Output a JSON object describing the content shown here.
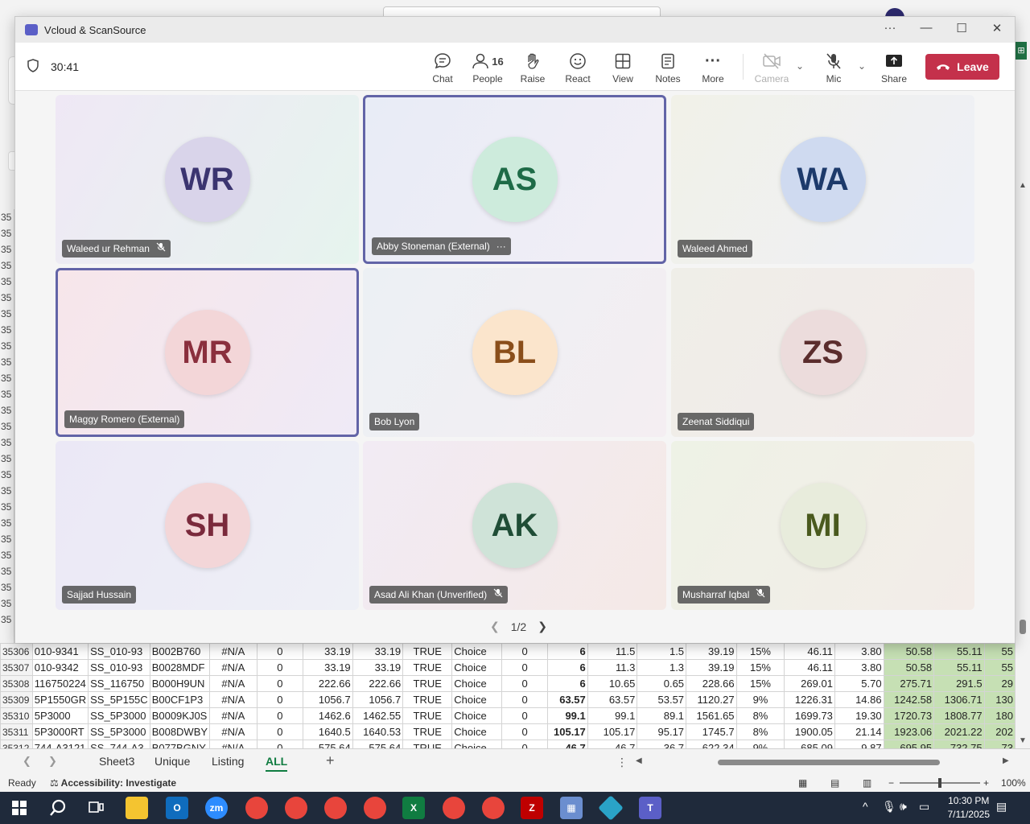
{
  "teams": {
    "window_title": "Vcloud & ScanSource",
    "timer": "30:41",
    "toolbar": {
      "chat": "Chat",
      "people": "People",
      "people_count": "16",
      "raise": "Raise",
      "react": "React",
      "view": "View",
      "notes": "Notes",
      "more": "More",
      "camera": "Camera",
      "mic": "Mic",
      "share": "Share",
      "leave": "Leave"
    },
    "participants": [
      {
        "initials": "WR",
        "name": "Waleed ur Rehman",
        "muted": true,
        "active": false,
        "color": "#d9d4ea",
        "text": "#3b3470"
      },
      {
        "initials": "AS",
        "name": "Abby Stoneman (External)",
        "muted": false,
        "active": true,
        "color": "#cdebdc",
        "text": "#1e6b47"
      },
      {
        "initials": "WA",
        "name": "Waleed Ahmed",
        "muted": false,
        "active": false,
        "color": "#cfdaf0",
        "text": "#1d3a6b"
      },
      {
        "initials": "MR",
        "name": "Maggy Romero (External)",
        "muted": false,
        "active": true,
        "color": "#f3d6d8",
        "text": "#8a2f3d"
      },
      {
        "initials": "BL",
        "name": "Bob Lyon",
        "muted": false,
        "active": false,
        "color": "#fbe5cc",
        "text": "#8a4e1a"
      },
      {
        "initials": "ZS",
        "name": "Zeenat Siddiqui",
        "muted": false,
        "active": false,
        "color": "#ecdcdc",
        "text": "#5b2d2d"
      },
      {
        "initials": "SH",
        "name": "Sajjad Hussain",
        "muted": false,
        "active": false,
        "color": "#f3d6d8",
        "text": "#7a2a3c"
      },
      {
        "initials": "AK",
        "name": "Asad Ali Khan (Unverified)",
        "muted": true,
        "active": false,
        "color": "#cfe3d8",
        "text": "#1f4d36"
      },
      {
        "initials": "MI",
        "name": "Musharraf Iqbal",
        "muted": true,
        "active": false,
        "color": "#e8ecdc",
        "text": "#4a5a1e"
      }
    ],
    "pager": "1/2"
  },
  "excel": {
    "rownums_visible": [
      "35",
      "35",
      "35",
      "35",
      "35",
      "35",
      "35",
      "35",
      "35",
      "35",
      "35",
      "35",
      "35",
      "35",
      "35",
      "35",
      "35",
      "35",
      "35",
      "35",
      "35",
      "35",
      "35",
      "35",
      "35",
      "35"
    ],
    "rows": [
      {
        "n": "35306",
        "a": "010-9341",
        "b": "SS_010-93",
        "c": "B002B760",
        "d": "#N/A",
        "e": "0",
        "f": "33.19",
        "g": "33.19",
        "h": "TRUE",
        "i": "Choice",
        "j": "0",
        "k": "6",
        "l": "11.5",
        "m": "1.5",
        "o": "39.19",
        "p": "15%",
        "q": "46.11",
        "r": "3.80",
        "s": "50.58",
        "t": "55.11",
        "u": "55"
      },
      {
        "n": "35307",
        "a": "010-9342",
        "b": "SS_010-93",
        "c": "B0028MDF",
        "d": "#N/A",
        "e": "0",
        "f": "33.19",
        "g": "33.19",
        "h": "TRUE",
        "i": "Choice",
        "j": "0",
        "k": "6",
        "l": "11.3",
        "m": "1.3",
        "o": "39.19",
        "p": "15%",
        "q": "46.11",
        "r": "3.80",
        "s": "50.58",
        "t": "55.11",
        "u": "55"
      },
      {
        "n": "35308",
        "a": "116750224",
        "b": "SS_116750",
        "c": "B000H9UN",
        "d": "#N/A",
        "e": "0",
        "f": "222.66",
        "g": "222.66",
        "h": "TRUE",
        "i": "Choice",
        "j": "0",
        "k": "6",
        "l": "10.65",
        "m": "0.65",
        "o": "228.66",
        "p": "15%",
        "q": "269.01",
        "r": "5.70",
        "s": "275.71",
        "t": "291.5",
        "u": "29"
      },
      {
        "n": "35309",
        "a": "5P1550GR",
        "b": "SS_5P155C",
        "c": "B00CF1P3",
        "d": "#N/A",
        "e": "0",
        "f": "1056.7",
        "g": "1056.7",
        "h": "TRUE",
        "i": "Choice",
        "j": "0",
        "k": "63.57",
        "l": "63.57",
        "m": "53.57",
        "o": "1120.27",
        "p": "9%",
        "q": "1226.31",
        "r": "14.86",
        "s": "1242.58",
        "t": "1306.71",
        "u": "130"
      },
      {
        "n": "35310",
        "a": "5P3000",
        "b": "SS_5P3000",
        "c": "B0009KJ0S",
        "d": "#N/A",
        "e": "0",
        "f": "1462.6",
        "g": "1462.55",
        "h": "TRUE",
        "i": "Choice",
        "j": "0",
        "k": "99.1",
        "l": "99.1",
        "m": "89.1",
        "o": "1561.65",
        "p": "8%",
        "q": "1699.73",
        "r": "19.30",
        "s": "1720.73",
        "t": "1808.77",
        "u": "180"
      },
      {
        "n": "35311",
        "a": "5P3000RT",
        "b": "SS_5P3000",
        "c": "B008DWBY",
        "d": "#N/A",
        "e": "0",
        "f": "1640.5",
        "g": "1640.53",
        "h": "TRUE",
        "i": "Choice",
        "j": "0",
        "k": "105.17",
        "l": "105.17",
        "m": "95.17",
        "o": "1745.7",
        "p": "8%",
        "q": "1900.05",
        "r": "21.14",
        "s": "1923.06",
        "t": "2021.22",
        "u": "202"
      },
      {
        "n": "35312",
        "a": "744-A3121",
        "b": "SS_744-A3",
        "c": "B077BGNY",
        "d": "#N/A",
        "e": "0",
        "f": "575.64",
        "g": "575.64",
        "h": "TRUE",
        "i": "Choice",
        "j": "0",
        "k": "46.7",
        "l": "46.7",
        "m": "36.7",
        "o": "622.34",
        "p": "9%",
        "q": "685.09",
        "r": "9.87",
        "s": "695.95",
        "t": "732.75",
        "u": "73"
      }
    ],
    "sheets": [
      "Sheet3",
      "Unique",
      "Listing",
      "ALL"
    ],
    "status_ready": "Ready",
    "accessibility": "Accessibility: Investigate",
    "zoom": "100%"
  },
  "taskbar": {
    "time": "10:30 PM",
    "date": "7/11/2025"
  }
}
